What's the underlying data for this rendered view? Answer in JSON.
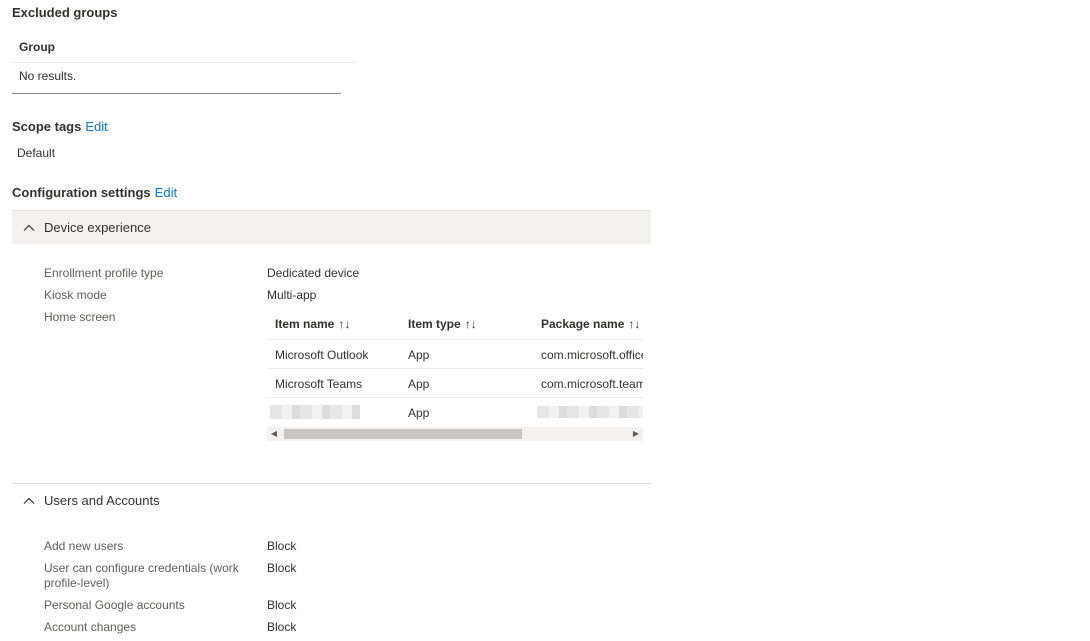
{
  "excluded_groups": {
    "title": "Excluded groups",
    "column_header": "Group",
    "empty_text": "No results."
  },
  "scope_tags": {
    "title": "Scope tags",
    "edit_label": "Edit",
    "value": "Default"
  },
  "configuration_settings": {
    "title": "Configuration settings",
    "edit_label": "Edit"
  },
  "device_experience": {
    "title": "Device experience",
    "rows": [
      {
        "label": "Enrollment profile type",
        "value": "Dedicated device"
      },
      {
        "label": "Kiosk mode",
        "value": "Multi-app"
      },
      {
        "label": "Home screen",
        "value": ""
      }
    ],
    "home_screen_table": {
      "headers": [
        "Item name",
        "Item type",
        "Package name"
      ],
      "sort_glyph": "↑↓",
      "rows": [
        {
          "name": "Microsoft Outlook",
          "type": "App",
          "package": "com.microsoft.office"
        },
        {
          "name": "Microsoft Teams",
          "type": "App",
          "package": "com.microsoft.team"
        },
        {
          "name": "",
          "type": "App",
          "package": ""
        }
      ]
    }
  },
  "users_and_accounts": {
    "title": "Users and Accounts",
    "rows": [
      {
        "label": "Add new users",
        "value": "Block"
      },
      {
        "label": "User can configure credentials (work profile-level)",
        "value": "Block"
      },
      {
        "label": "Personal Google accounts",
        "value": "Block"
      },
      {
        "label": "Account changes",
        "value": "Block"
      }
    ]
  },
  "colors": {
    "link": "#0078d4",
    "section_bar": "#f3f2f1",
    "text": "#323130",
    "label": "#605e5c"
  }
}
